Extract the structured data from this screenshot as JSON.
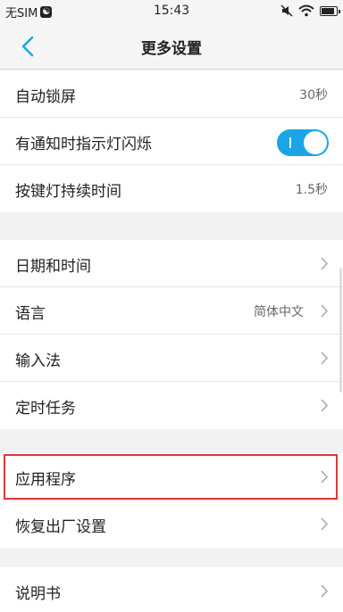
{
  "status_bar": {
    "carrier": "无SIM",
    "time": "15:43",
    "battery_level": 0.85
  },
  "header": {
    "title": "更多设置"
  },
  "groups": [
    {
      "rows": [
        {
          "label": "自动锁屏",
          "value": "30秒"
        },
        {
          "label": "有通知时指示灯闪烁",
          "toggle_on": true
        },
        {
          "label": "按键灯持续时间",
          "value": "1.5秒"
        }
      ]
    },
    {
      "rows": [
        {
          "label": "日期和时间"
        },
        {
          "label": "语言",
          "value": "简体中文"
        },
        {
          "label": "输入法"
        },
        {
          "label": "定时任务"
        }
      ]
    },
    {
      "rows": [
        {
          "label": "应用程序",
          "highlighted": true
        },
        {
          "label": "恢复出厂设置"
        }
      ]
    },
    {
      "rows": [
        {
          "label": "说明书"
        }
      ]
    }
  ],
  "colors": {
    "accent": "#1aa6e6",
    "highlight_border": "#d9393a",
    "background": "#f2f2f2"
  }
}
